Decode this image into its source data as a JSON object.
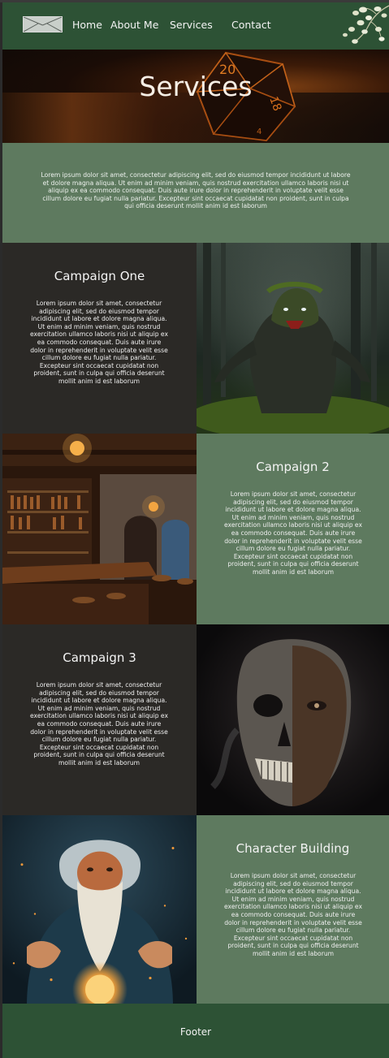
{
  "nav": {
    "items": [
      {
        "label": "Home"
      },
      {
        "label": "About Me"
      },
      {
        "label": "Services"
      },
      {
        "label": "Contact"
      }
    ]
  },
  "hero": {
    "title": "Services"
  },
  "intro": {
    "text": "Lorem ipsum dolor sit amet, consectetur adipiscing elit, sed do eiusmod tempor incididunt ut labore et dolore magna aliqua. Ut enim ad minim veniam, quis nostrud exercitation ullamco laboris nisi ut aliquip ex ea commodo consequat. Duis aute irure dolor in reprehenderit in voluptate velit esse cillum dolore eu fugiat nulla pariatur. Excepteur sint occaecat cupidatat non proident, sunt in culpa qui officia deserunt mollit anim id est laborum"
  },
  "cards": [
    {
      "title": "Campaign One",
      "text": "Lorem ipsum dolor sit amet, consectetur adipiscing elit, sed do eiusmod tempor incididunt ut labore et dolore magna aliqua. Ut enim ad minim veniam, quis nostrud exercitation ullamco laboris nisi ut aliquip ex ea commodo consequat. Duis aute irure dolor in reprehenderit in voluptate velit esse cillum dolore eu fugiat nulla pariatur. Excepteur sint occaecat cupidatat non proident, sunt in culpa qui officia deserunt mollit anim id est laborum",
      "image": "forest-monster-image"
    },
    {
      "title": "Campaign 2",
      "text": "Lorem ipsum dolor sit amet, consectetur adipiscing elit, sed do eiusmod tempor incididunt ut labore et dolore magna aliqua. Ut enim ad minim veniam, quis nostrud exercitation ullamco laboris nisi ut aliquip ex ea commodo consequat. Duis aute irure dolor in reprehenderit in voluptate velit esse cillum dolore eu fugiat nulla pariatur. Excepteur sint occaecat cupidatat non proident, sunt in culpa qui officia deserunt mollit anim id est laborum",
      "image": "tavern-image"
    },
    {
      "title": "Campaign 3",
      "text": "Lorem ipsum dolor sit amet, consectetur adipiscing elit, sed do eiusmod tempor incididunt ut labore et dolore magna aliqua. Ut enim ad minim veniam, quis nostrud exercitation ullamco laboris nisi ut aliquip ex ea commodo consequat. Duis aute irure dolor in reprehenderit in voluptate velit esse cillum dolore eu fugiat nulla pariatur. Excepteur sint occaecat cupidatat non proident, sunt in culpa qui officia deserunt mollit anim id est laborum",
      "image": "half-skull-face-image"
    },
    {
      "title": "Character Building",
      "text": "Lorem ipsum dolor sit amet, consectetur adipiscing elit, sed do eiusmod tempor incididunt ut labore et dolore magna aliqua. Ut enim ad minim veniam, quis nostrud exercitation ullamco laboris nisi ut aliquip ex ea commodo consequat. Duis aute irure dolor in reprehenderit in voluptate velit esse cillum dolore eu fugiat nulla pariatur. Excepteur sint occaecat cupidatat non proident, sunt in culpa qui officia deserunt mollit anim id est laborum",
      "image": "wizard-orb-image"
    }
  ],
  "footer": {
    "text": "Footer"
  },
  "colors": {
    "header_green": "#2d5235",
    "panel_green": "#5e7a5f",
    "panel_dark": "#2b2926",
    "text_light": "#f4f4f4"
  }
}
